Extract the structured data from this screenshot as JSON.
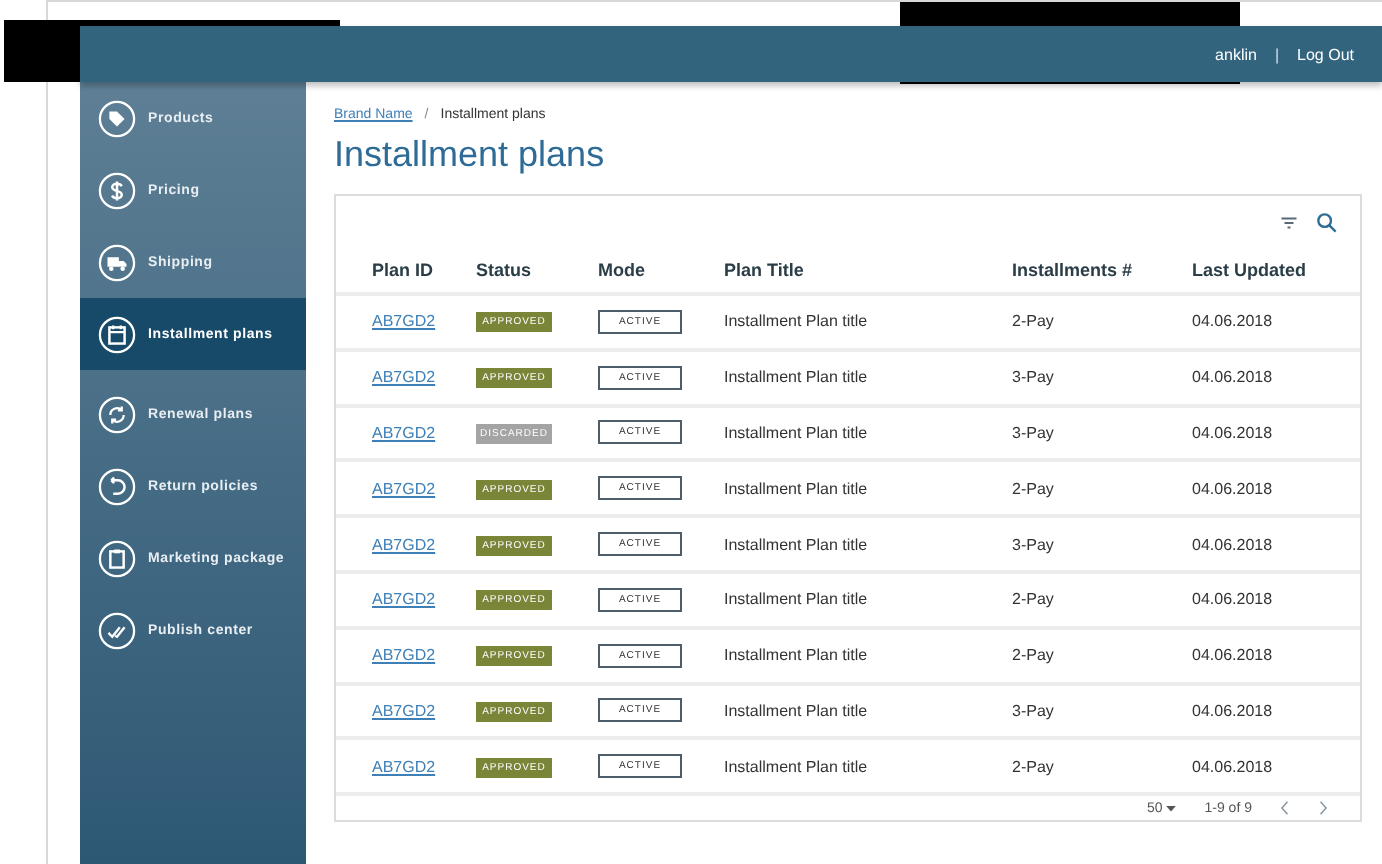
{
  "header": {
    "user": "anklin",
    "separator": "|",
    "logout": "Log Out"
  },
  "sidebar": {
    "items": [
      {
        "label": "Products",
        "selected": false
      },
      {
        "label": "Pricing",
        "selected": false
      },
      {
        "label": "Shipping",
        "selected": false
      },
      {
        "label": "Installment plans",
        "selected": true
      },
      {
        "label": "Renewal plans",
        "selected": false
      },
      {
        "label": "Return policies",
        "selected": false
      },
      {
        "label": "Marketing package",
        "selected": false
      },
      {
        "label": "Publish center",
        "selected": false
      }
    ]
  },
  "breadcrumb": {
    "link": "Brand Name",
    "separator": "/",
    "current": "Installment plans"
  },
  "title": "Installment plans",
  "table": {
    "columns": [
      "Plan ID",
      "Status",
      "Mode",
      "Plan Title",
      "Installments #",
      "Last Updated"
    ],
    "rows": [
      {
        "id": "AB7GD2",
        "status": "APPROVED",
        "kind": "approved",
        "mode": "ACTIVE",
        "title": "Installment Plan title",
        "installments": "2-Pay",
        "updated": "04.06.2018"
      },
      {
        "id": "AB7GD2",
        "status": "APPROVED",
        "kind": "approved",
        "mode": "ACTIVE",
        "title": "Installment Plan title",
        "installments": "3-Pay",
        "updated": "04.06.2018"
      },
      {
        "id": "AB7GD2",
        "status": "DISCARDED",
        "kind": "discarded",
        "mode": "ACTIVE",
        "title": "Installment Plan title",
        "installments": "3-Pay",
        "updated": "04.06.2018"
      },
      {
        "id": "AB7GD2",
        "status": "APPROVED",
        "kind": "approved",
        "mode": "ACTIVE",
        "title": "Installment Plan title",
        "installments": "2-Pay",
        "updated": "04.06.2018"
      },
      {
        "id": "AB7GD2",
        "status": "APPROVED",
        "kind": "approved",
        "mode": "ACTIVE",
        "title": "Installment Plan title",
        "installments": "3-Pay",
        "updated": "04.06.2018"
      },
      {
        "id": "AB7GD2",
        "status": "APPROVED",
        "kind": "approved",
        "mode": "ACTIVE",
        "title": "Installment Plan title",
        "installments": "2-Pay",
        "updated": "04.06.2018"
      },
      {
        "id": "AB7GD2",
        "status": "APPROVED",
        "kind": "approved",
        "mode": "ACTIVE",
        "title": "Installment Plan title",
        "installments": "2-Pay",
        "updated": "04.06.2018"
      },
      {
        "id": "AB7GD2",
        "status": "APPROVED",
        "kind": "approved",
        "mode": "ACTIVE",
        "title": "Installment Plan title",
        "installments": "3-Pay",
        "updated": "04.06.2018"
      },
      {
        "id": "AB7GD2",
        "status": "APPROVED",
        "kind": "approved",
        "mode": "ACTIVE",
        "title": "Installment Plan title",
        "installments": "2-Pay",
        "updated": "04.06.2018"
      }
    ],
    "pagination": {
      "page_size": "50",
      "range": "1-9 of 9"
    }
  }
}
